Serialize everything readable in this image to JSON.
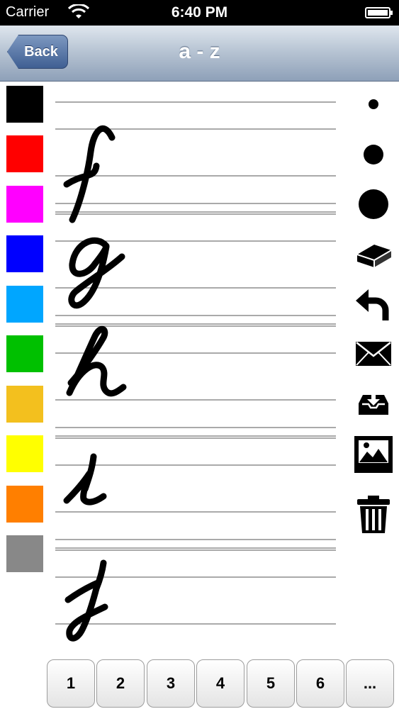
{
  "status_bar": {
    "carrier": "Carrier",
    "time": "6:40 PM"
  },
  "nav": {
    "back_label": "Back",
    "title": "a - z"
  },
  "colors": [
    {
      "name": "black",
      "hex": "#000000"
    },
    {
      "name": "red",
      "hex": "#ff0000"
    },
    {
      "name": "magenta",
      "hex": "#ff00ff"
    },
    {
      "name": "blue",
      "hex": "#0000ff"
    },
    {
      "name": "sky-blue",
      "hex": "#00a6ff"
    },
    {
      "name": "green",
      "hex": "#00c000"
    },
    {
      "name": "amber",
      "hex": "#f3c01e"
    },
    {
      "name": "yellow",
      "hex": "#ffff00"
    },
    {
      "name": "orange",
      "hex": "#ff7f00"
    },
    {
      "name": "gray",
      "hex": "#888888"
    }
  ],
  "letters": [
    "f",
    "g",
    "h",
    "i",
    "j"
  ],
  "tools": [
    "small-brush-icon",
    "medium-brush-icon",
    "large-brush-icon",
    "eraser-icon",
    "undo-icon",
    "mail-icon",
    "save-tray-icon",
    "photo-icon",
    "trash-icon"
  ],
  "pages": [
    "1",
    "2",
    "3",
    "4",
    "5",
    "6",
    "..."
  ]
}
